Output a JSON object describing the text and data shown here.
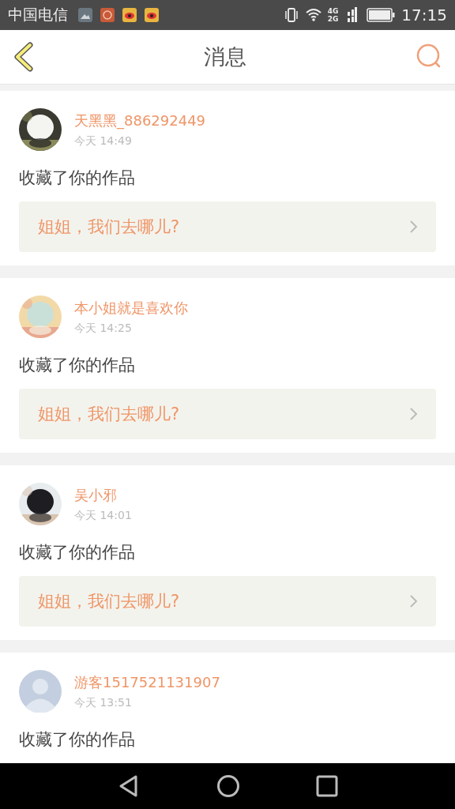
{
  "status_bar": {
    "carrier": "中国电信",
    "network_top": "4G",
    "network_bottom": "2G",
    "time": "17:15"
  },
  "header": {
    "title": "消息"
  },
  "messages": [
    {
      "user": "天黑黑_886292449",
      "time": "今天 14:49",
      "action": "收藏了你的作品",
      "work": "姐姐，我们去哪儿?"
    },
    {
      "user": "本小姐就是喜欢你",
      "time": "今天 14:25",
      "action": "收藏了你的作品",
      "work": "姐姐，我们去哪儿?"
    },
    {
      "user": "吴小邪",
      "time": "今天 14:01",
      "action": "收藏了你的作品",
      "work": "姐姐，我们去哪儿?"
    },
    {
      "user": "游客1517521131907",
      "time": "今天 13:51",
      "avatar": {
        "kind": "default"
      },
      "action": "收藏了你的作品"
    }
  ]
}
